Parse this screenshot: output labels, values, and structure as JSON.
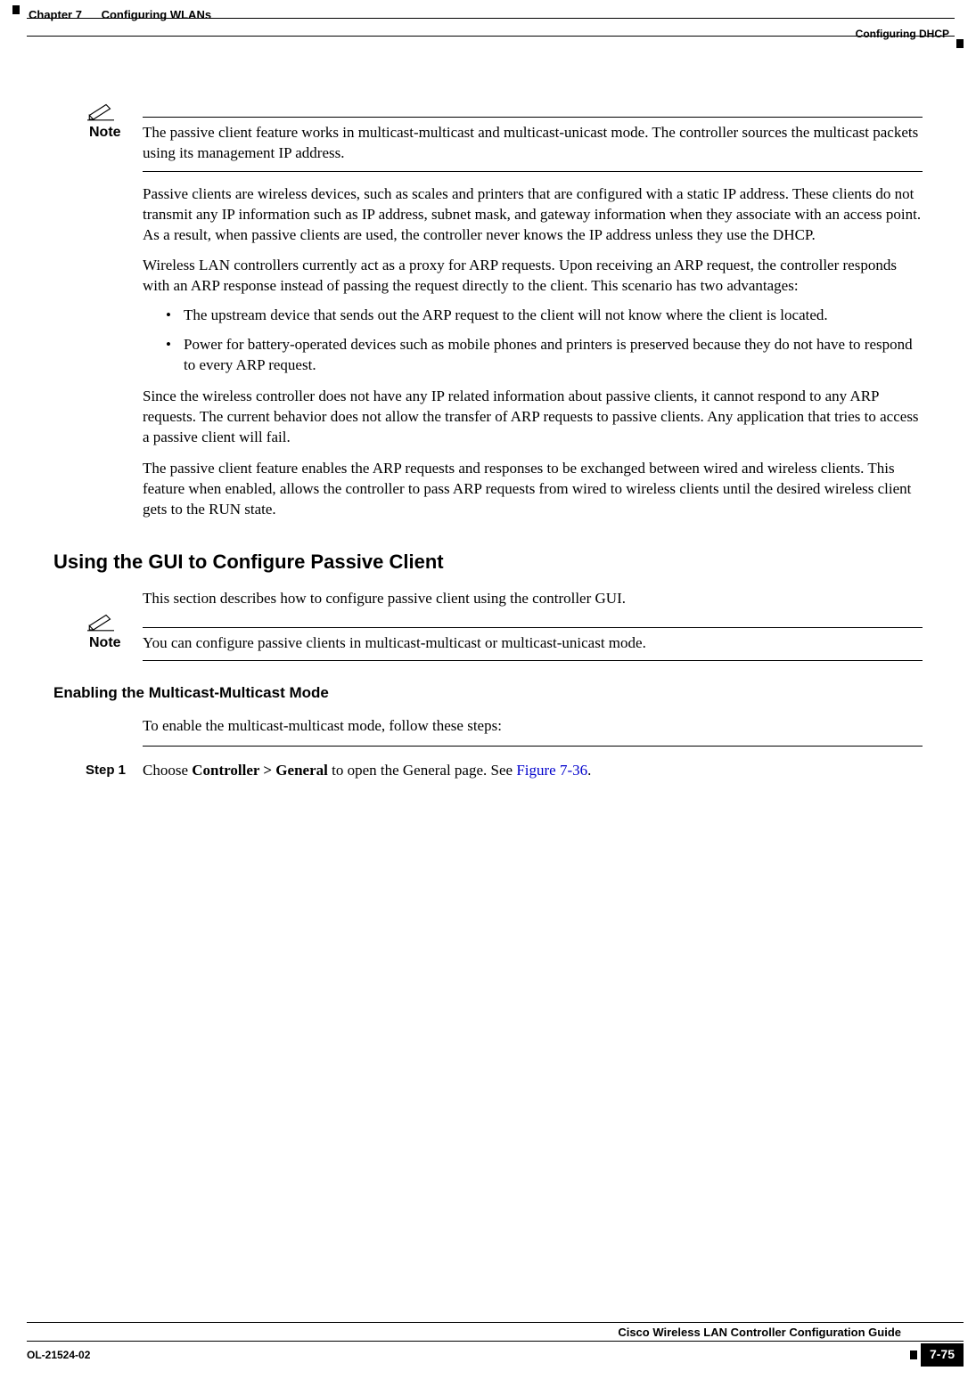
{
  "header": {
    "chapter_num": "Chapter 7",
    "chapter_title": "Configuring WLANs",
    "section": "Configuring DHCP"
  },
  "note1": {
    "label": "Note",
    "text": "The passive client feature works in multicast-multicast and multicast-unicast mode. The controller sources the multicast packets using its management IP address."
  },
  "para1": "Passive clients are wireless devices, such as scales and printers that are configured with a static IP address. These clients do not transmit any IP information such as IP address, subnet mask, and gateway information when they associate with an access point. As a result, when passive clients are used, the controller never knows the IP address unless they use the DHCP.",
  "para2": "Wireless LAN controllers currently act as a proxy for ARP requests. Upon receiving an ARP request, the controller responds with an ARP response instead of passing the request directly to the client. This scenario has two advantages:",
  "bullets1": [
    "The upstream device that sends out the ARP request to the client will not know where the client is located.",
    "Power for battery-operated devices such as mobile phones and printers is preserved because they do not have to respond to every ARP request."
  ],
  "para3": "Since the wireless controller does not have any IP related information about passive clients, it cannot respond to any ARP requests. The current behavior does not allow the transfer of ARP requests to passive clients. Any application that tries to access a passive client will fail.",
  "para4": "The passive client feature enables the ARP requests and responses to be exchanged between wired and wireless clients. This feature when enabled, allows the controller to pass ARP requests from wired to wireless clients until the desired wireless client gets to the RUN state.",
  "h2_1": "Using the GUI to Configure Passive Client",
  "para5": "This section describes how to configure passive client using the controller GUI.",
  "note2": {
    "label": "Note",
    "text": "You can configure passive clients in multicast-multicast or multicast-unicast mode."
  },
  "h3_1": "Enabling the Multicast-Multicast Mode",
  "para6": "To enable the multicast-multicast mode, follow these steps:",
  "step1": {
    "label": "Step 1",
    "pre": "Choose ",
    "bold": "Controller > General",
    "mid": " to open the General page. See ",
    "link": "Figure 7-36",
    "post": "."
  },
  "footer": {
    "guide": "Cisco Wireless LAN Controller Configuration Guide",
    "doc": "OL-21524-02",
    "page": "7-75"
  }
}
